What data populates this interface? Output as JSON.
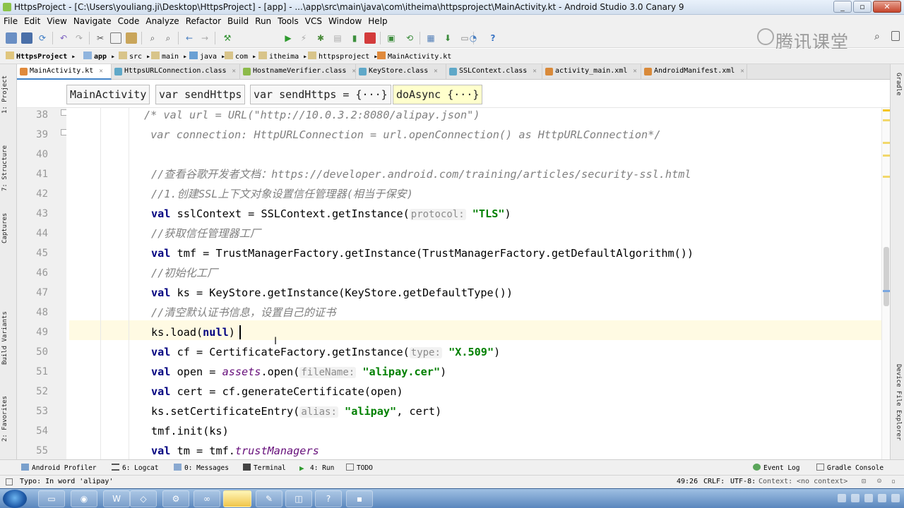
{
  "window": {
    "title": "HttpsProject - [C:\\Users\\youliang.ji\\Desktop\\HttpsProject] - [app] - ...\\app\\src\\main\\java\\com\\itheima\\httpsproject\\MainActivity.kt - Android Studio 3.0 Canary 9"
  },
  "menu": [
    "File",
    "Edit",
    "View",
    "Navigate",
    "Code",
    "Analyze",
    "Refactor",
    "Build",
    "Run",
    "Tools",
    "VCS",
    "Window",
    "Help"
  ],
  "toolbar": {
    "run_config": "app"
  },
  "watermark": "腾讯课堂",
  "breadcrumbs": [
    "HttpsProject",
    "app",
    "src",
    "main",
    "java",
    "com",
    "itheima",
    "httpsproject",
    "MainActivity.kt"
  ],
  "tabs": [
    {
      "label": "MainActivity.kt",
      "active": true
    },
    {
      "label": "HttpsURLConnection.class"
    },
    {
      "label": "HostnameVerifier.class"
    },
    {
      "label": "KeyStore.class"
    },
    {
      "label": "SSLContext.class"
    },
    {
      "label": "activity_main.xml"
    },
    {
      "label": "AndroidManifest.xml"
    }
  ],
  "code_breadcrumbs": [
    "MainActivity",
    "var sendHttps",
    "var sendHttps = {···}",
    "doAsync {···}"
  ],
  "left_tools": [
    "1: Project",
    "7: Structure",
    "Captures",
    "Build Variants",
    "2: Favorites"
  ],
  "right_tools": [
    "Gradle",
    "Device File Explorer"
  ],
  "line_numbers": [
    "38",
    "39",
    "40",
    "41",
    "42",
    "43",
    "44",
    "45",
    "46",
    "47",
    "48",
    "49",
    "50",
    "51",
    "52",
    "53",
    "54",
    "55"
  ],
  "code": {
    "l38": "/* val url = URL(\"http://10.0.3.2:8080/alipay.json\")",
    "l39": " var connection: HttpURLConnection = url.openConnection() as HttpURLConnection*/",
    "l41": "//查看谷歌开发者文档：https://developer.android.com/training/articles/security-ssl.html",
    "l42": "//1.创建SSL上下文对象设置信任管理器(相当于保安)",
    "l43_kw": "val",
    "l43_a": " sslContext = SSLContext.getInstance(",
    "l43_hint": "protocol:",
    "l43_str": "\"TLS\"",
    "l43_b": ")",
    "l44": "//获取信任管理器工厂",
    "l45_kw": "val",
    "l45_a": " tmf = TrustManagerFactory.getInstance(TrustManagerFactory.getDefaultAlgorithm())",
    "l46": "//初始化工厂",
    "l47_kw": "val",
    "l47_a": " ks = KeyStore.getInstance(KeyStore.getDefaultType())",
    "l48": "//清空默认证书信息，设置自己的证书",
    "l49_a": "ks.load(",
    "l49_kw": "null",
    "l49_b": ")",
    "l50_kw": "val",
    "l50_a": " cf = CertificateFactory.getInstance(",
    "l50_hint": "type:",
    "l50_str": "\"X.509\"",
    "l50_b": ")",
    "l51_kw": "val",
    "l51_a": " open = ",
    "l51_it": "assets",
    "l51_b": ".open(",
    "l51_hint": "fileName:",
    "l51_str": "\"alipay.cer\"",
    "l51_c": ")",
    "l52_kw": "val",
    "l52_a": " cert = cf.generateCertificate(open)",
    "l53_a": "ks.setCertificateEntry(",
    "l53_hint": "alias:",
    "l53_str": "\"alipay\"",
    "l53_b": ", cert)",
    "l54_a": "tmf.init(ks)",
    "l55_kw": "val",
    "l55_a": " tm = tmf.",
    "l55_it": "trustManagers"
  },
  "bottom_tools": [
    "Android Profiler",
    "6: Logcat",
    "0: Messages",
    "Terminal",
    "4: Run",
    "TODO"
  ],
  "bottom_tools_right": [
    "Event Log",
    "Gradle Console"
  ],
  "status": {
    "message": "Typo: In word 'alipay'",
    "position": "49:26",
    "line_sep": "CRLF:",
    "encoding": "UTF-8:",
    "context_label": "Context:",
    "context_value": "<no context>"
  },
  "colors": {
    "keyword": "#000080",
    "string": "#008000",
    "comment": "#808080",
    "current_line": "#fffae3"
  }
}
